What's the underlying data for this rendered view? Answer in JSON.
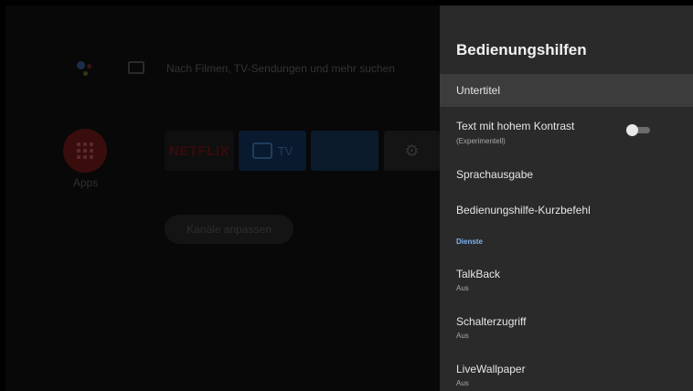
{
  "home": {
    "search_hint": "Nach Filmen, TV-Sendungen und mehr suchen",
    "apps_label": "Apps",
    "tiles": {
      "netflix": "NETFLIX",
      "tv": "TV"
    },
    "channels_button": "Kanäle anpassen"
  },
  "panel": {
    "title": "Bedienungshilfen",
    "items": [
      {
        "label": "Untertitel",
        "selected": true
      },
      {
        "label": "Text mit hohem Kontrast",
        "sub": "(Experimentell)",
        "toggle": "off"
      },
      {
        "label": "Sprachausgabe"
      },
      {
        "label": "Bedienungshilfe-Kurzbefehl"
      }
    ],
    "section": "Dienste",
    "services": [
      {
        "label": "TalkBack",
        "sub": "Aus"
      },
      {
        "label": "Schalterzugriff",
        "sub": "Aus"
      },
      {
        "label": "LiveWallpaper",
        "sub": "Aus"
      }
    ]
  },
  "colors": {
    "panel_bg": "#2a2a2b",
    "selected_bg": "#3c3c3d",
    "section": "#7fb3ee"
  }
}
